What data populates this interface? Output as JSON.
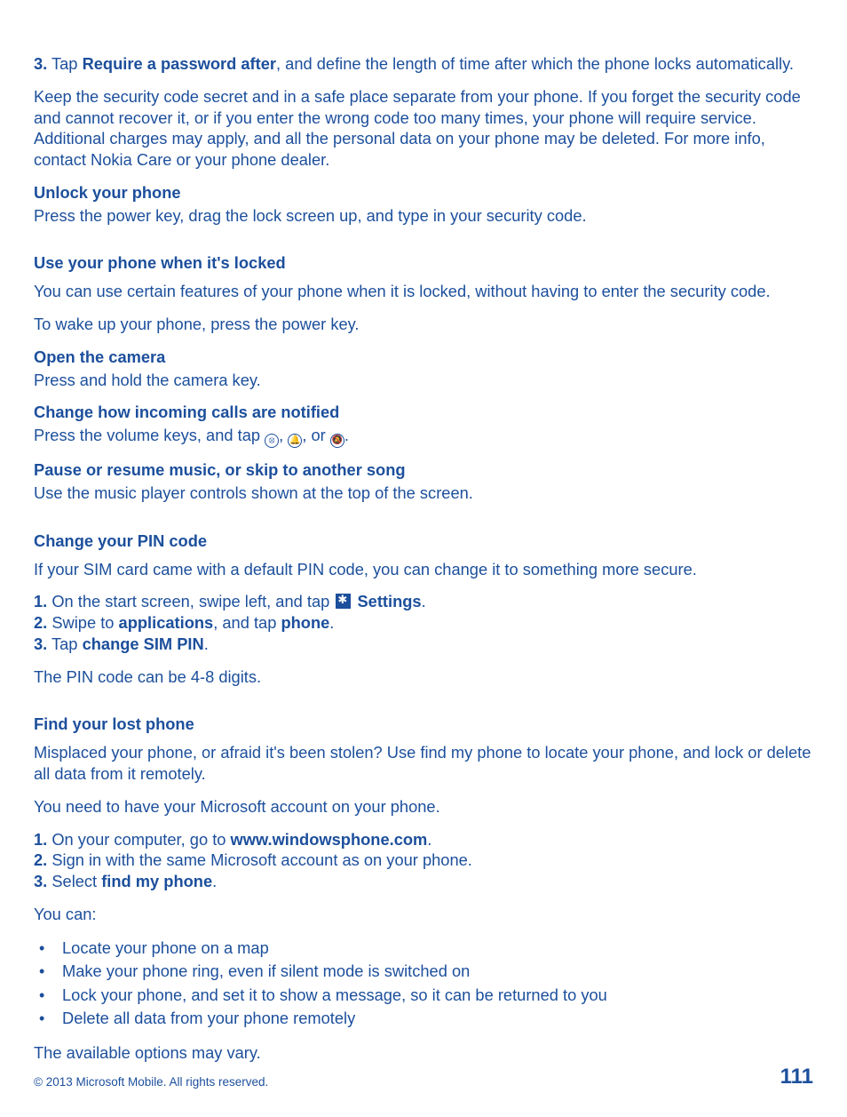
{
  "step3_prefix": "3.",
  "step3_a": " Tap ",
  "step3_bold": "Require a password after",
  "step3_b": ", and define the length of time after which the phone locks automatically.",
  "keep_secret": "Keep the security code secret and in a safe place separate from your phone. If you forget the security code and cannot recover it, or if you enter the wrong code too many times, your phone will require service. Additional charges may apply, and all the personal data on your phone may be deleted. For more info, contact Nokia Care or your phone dealer.",
  "unlock_h": "Unlock your phone",
  "unlock_t": "Press the power key, drag the lock screen up, and type in your security code.",
  "use_locked_h": "Use your phone when it's locked",
  "use_locked_t": "You can use certain features of your phone when it is locked, without having to enter the security code.",
  "wake_t": "To wake up your phone, press the power key.",
  "open_cam_h": "Open the camera",
  "open_cam_t": "Press and hold the camera key.",
  "change_calls_h": "Change how incoming calls are notified",
  "change_calls_a": "Press the volume keys, and tap ",
  "change_calls_b": ", ",
  "change_calls_c": ", or ",
  "change_calls_d": ".",
  "pause_h": "Pause or resume music, or skip to another song",
  "pause_t": "Use the music player controls shown at the top of the screen.",
  "pin_h": "Change your PIN code",
  "pin_t": "If your SIM card came with a default PIN code, you can change it to something more secure.",
  "pin_s1_n": "1.",
  "pin_s1_a": " On the start screen, swipe left, and tap ",
  "pin_s1_b": " ",
  "pin_s1_c": "Settings",
  "pin_s1_d": ".",
  "pin_s2_n": "2.",
  "pin_s2_a": " Swipe to ",
  "pin_s2_b": "applications",
  "pin_s2_c": ", and tap ",
  "pin_s2_d": "phone",
  "pin_s2_e": ".",
  "pin_s3_n": "3.",
  "pin_s3_a": " Tap ",
  "pin_s3_b": "change SIM PIN",
  "pin_s3_c": ".",
  "pin_note": "The PIN code can be 4-8 digits.",
  "find_h": "Find your lost phone",
  "find_t": "Misplaced your phone, or afraid it's been stolen? Use find my phone to locate your phone, and lock or delete all data from it remotely.",
  "find_ms": "You need to have your Microsoft account on your phone.",
  "find_s1_n": "1.",
  "find_s1_a": " On your computer, go to ",
  "find_s1_b": "www.windowsphone.com",
  "find_s1_c": ".",
  "find_s2_n": "2.",
  "find_s2_a": " Sign in with the same Microsoft account as on your phone.",
  "find_s3_n": "3.",
  "find_s3_a": " Select ",
  "find_s3_b": "find my phone",
  "find_s3_c": ".",
  "youcan": "You can:",
  "bullets": {
    "b1": "Locate your phone on a map",
    "b2": "Make your phone ring, even if silent mode is switched on",
    "b3": "Lock your phone, and set it to show a message, so it can be returned to you",
    "b4": "Delete all data from your phone remotely"
  },
  "options_vary": "The available options may vary.",
  "copyright": "© 2013 Microsoft Mobile. All rights reserved.",
  "page": "111"
}
